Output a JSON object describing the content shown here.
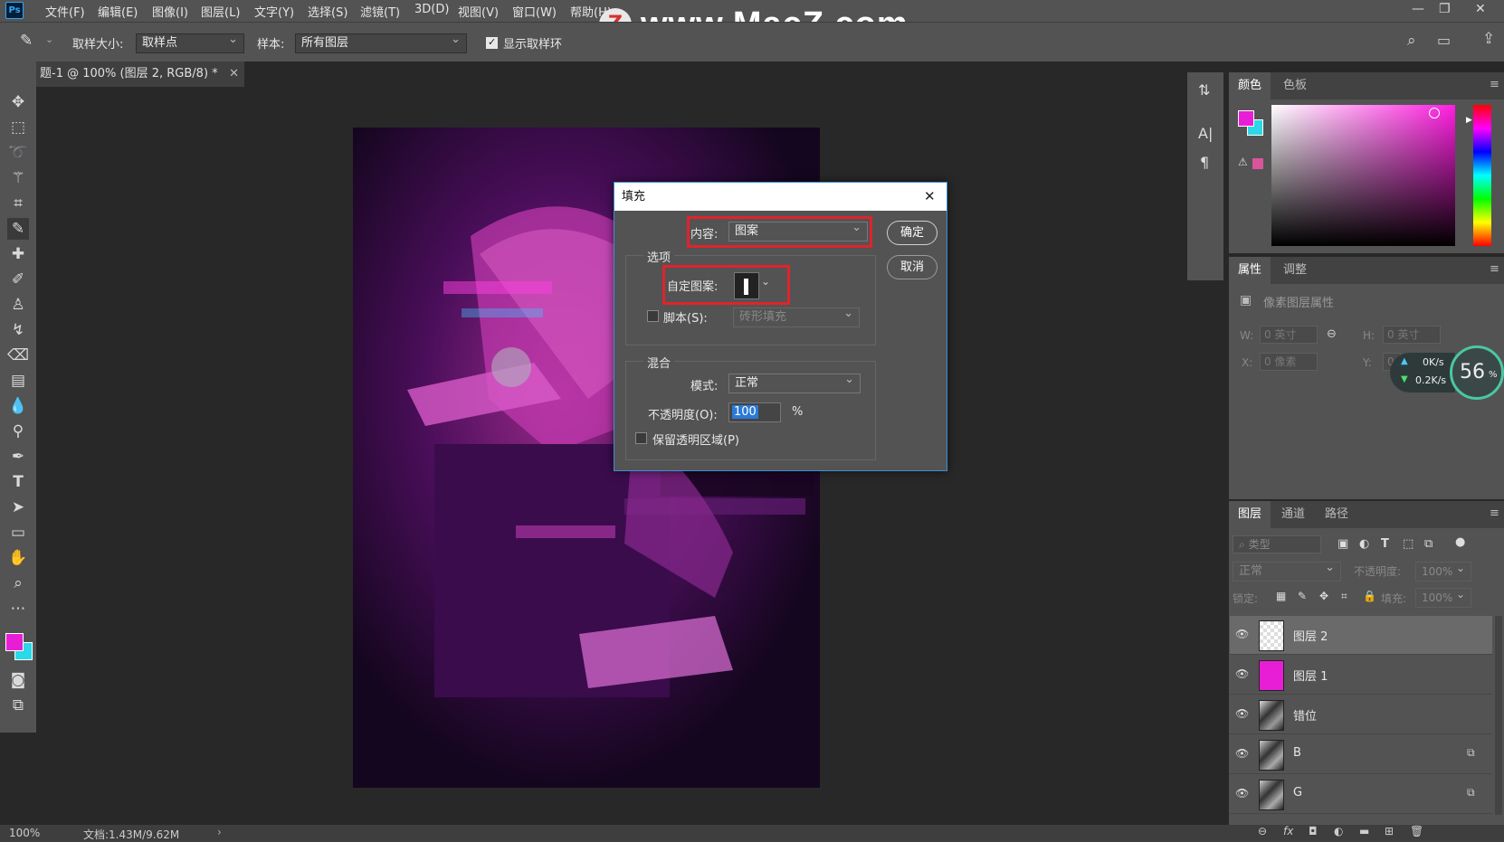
{
  "app": {
    "logo": "Ps"
  },
  "menu": [
    "文件(F)",
    "编辑(E)",
    "图像(I)",
    "图层(L)",
    "文字(Y)",
    "选择(S)",
    "滤镜(T)",
    "3D(D)",
    "视图(V)",
    "窗口(W)",
    "帮助(H)"
  ],
  "watermark": "www.MacZ.com",
  "options": {
    "sample_size_label": "取样大小:",
    "sample_size_value": "取样点",
    "sample_label": "样本:",
    "sample_value": "所有图层",
    "show_ring_label": "显示取样环"
  },
  "document": {
    "tab_title": "题-1 @ 100% (图层 2, RGB/8) *",
    "zoom": "100%",
    "doc_info": "文档:1.43M/9.62M"
  },
  "fill_dialog": {
    "title": "填充",
    "content_label": "内容:",
    "content_value": "图案",
    "ok": "确定",
    "cancel": "取消",
    "options_group": "选项",
    "custom_pattern_label": "自定图案:",
    "script_label": "脚本(S):",
    "script_value": "砖形填充",
    "blend_group": "混合",
    "mode_label": "模式:",
    "mode_value": "正常",
    "opacity_label": "不透明度(O):",
    "opacity_value": "100",
    "opacity_unit": "%",
    "preserve_label": "保留透明区域(P)"
  },
  "color_panel": {
    "tabs": [
      "颜色",
      "色板"
    ],
    "fg": "#e81ed6",
    "bg": "#2ad8e8"
  },
  "properties_panel": {
    "tabs": [
      "属性",
      "调整"
    ],
    "title": "像素图层属性",
    "w_label": "W:",
    "w_value": "0 英寸",
    "h_label": "H:",
    "h_value": "0 英寸",
    "x_label": "X:",
    "x_value": "0 像素",
    "y_label": "Y:",
    "y_value": "0",
    "net_up": "0K/s",
    "net_down": "0.2K/s",
    "net_percent": "56"
  },
  "layers_panel": {
    "tabs": [
      "图层",
      "通道",
      "路径"
    ],
    "filter_placeholder": "类型",
    "blend_mode": "正常",
    "opacity_label": "不透明度:",
    "opacity_value": "100%",
    "lock_label": "锁定:",
    "fill_label": "填充:",
    "fill_value": "100%",
    "layers": [
      {
        "name": "图层 2"
      },
      {
        "name": "图层 1"
      },
      {
        "name": "错位"
      },
      {
        "name": "B"
      },
      {
        "name": "G"
      }
    ]
  }
}
